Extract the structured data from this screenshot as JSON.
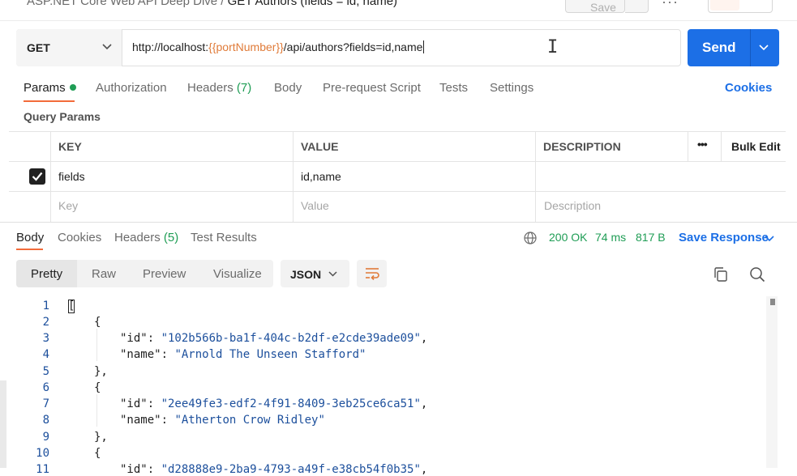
{
  "breadcrumb": {
    "collection": "ASP.NET Core Web API Deep Dive",
    "separator": "/",
    "request": "GET Authors (fields = id, name)"
  },
  "toolbar": {
    "save_label": "Save"
  },
  "request": {
    "method": "GET",
    "url_prefix": "http://localhost:",
    "url_variable": "{{portNumber}}",
    "url_suffix": "/api/authors?fields=id,name",
    "send_label": "Send"
  },
  "request_tabs": [
    {
      "label": "Params"
    },
    {
      "label": "Authorization"
    },
    {
      "label": "Headers",
      "count": "(7)"
    },
    {
      "label": "Body"
    },
    {
      "label": "Pre-request Script"
    },
    {
      "label": "Tests"
    },
    {
      "label": "Settings"
    }
  ],
  "cookies_link": "Cookies",
  "query_params": {
    "title": "Query Params",
    "headers": {
      "key": "KEY",
      "value": "VALUE",
      "description": "DESCRIPTION",
      "bulk_edit": "Bulk Edit",
      "more": "•••"
    },
    "rows": [
      {
        "key": "fields",
        "value": "id,name",
        "description": "",
        "checked": true
      }
    ],
    "placeholders": {
      "key": "Key",
      "value": "Value",
      "description": "Description"
    }
  },
  "response": {
    "tabs": [
      {
        "label": "Body"
      },
      {
        "label": "Cookies"
      },
      {
        "label": "Headers",
        "count": "(5)"
      },
      {
        "label": "Test Results"
      }
    ],
    "status": "200 OK",
    "time": "74 ms",
    "size": "817 B",
    "save_response_label": "Save Response",
    "view_modes": [
      "Pretty",
      "Raw",
      "Preview",
      "Visualize"
    ],
    "format": "JSON",
    "line_numbers": [
      "1",
      "2",
      "3",
      "4",
      "5",
      "6",
      "7",
      "8",
      "9",
      "10",
      "11"
    ],
    "code": {
      "l1": "[",
      "l2": "{",
      "id_key": "\"id\"",
      "name_key": "\"name\"",
      "id1": "\"102b566b-ba1f-404c-b2df-e2cde39ade09\"",
      "name1": "\"Arnold The Unseen Stafford\"",
      "l5": "},",
      "l6": "{",
      "id2": "\"2ee49fe3-edf2-4f91-8409-3eb25ce6ca51\"",
      "name2": "\"Atherton Crow Ridley\"",
      "l9": "},",
      "l10": "{",
      "id3": "\"d28888e9-2ba9-4793-a49f-e38cb54f0b35\""
    }
  },
  "colors": {
    "accent": "#f26b3a",
    "primary": "#1c6fe6",
    "success": "#1f9d55",
    "variable": "#e07b39"
  }
}
